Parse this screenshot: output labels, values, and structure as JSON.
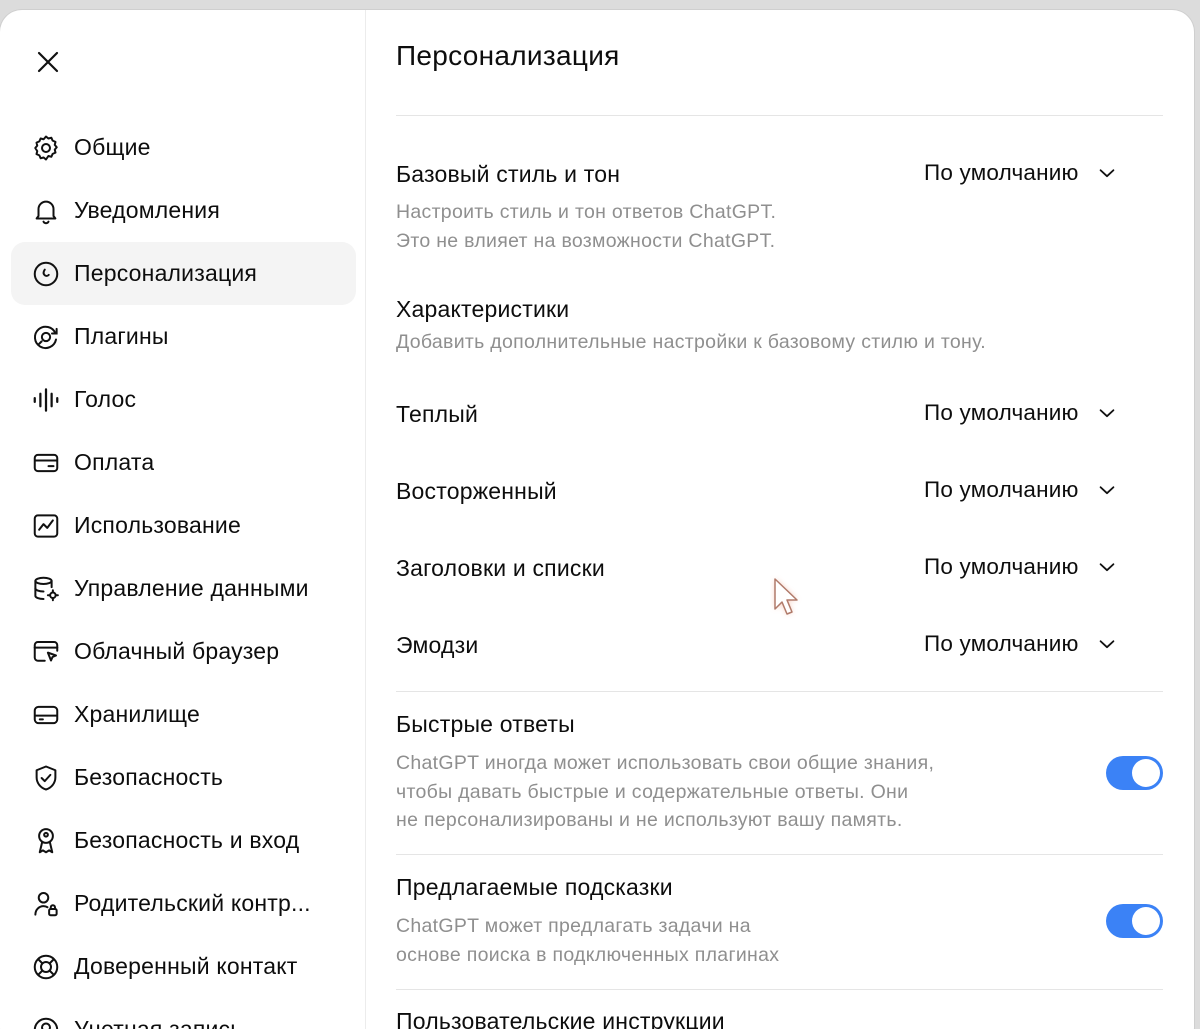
{
  "sidebar": {
    "close_icon": "close-icon",
    "items": [
      {
        "label": "Общие",
        "icon": "gear-icon",
        "active": false
      },
      {
        "label": "Уведомления",
        "icon": "bell-icon",
        "active": false
      },
      {
        "label": "Персонализация",
        "icon": "personalization-icon",
        "active": true
      },
      {
        "label": "Плагины",
        "icon": "plugins-icon",
        "active": false
      },
      {
        "label": "Голос",
        "icon": "voice-waveform-icon",
        "active": false
      },
      {
        "label": "Оплата",
        "icon": "credit-card-icon",
        "active": false
      },
      {
        "label": "Использование",
        "icon": "usage-chart-icon",
        "active": false
      },
      {
        "label": "Управление данными",
        "icon": "database-gear-icon",
        "active": false
      },
      {
        "label": "Облачный браузер",
        "icon": "cloud-browser-icon",
        "active": false
      },
      {
        "label": "Хранилище",
        "icon": "storage-icon",
        "active": false
      },
      {
        "label": "Безопасность",
        "icon": "shield-check-icon",
        "active": false
      },
      {
        "label": "Безопасность и вход",
        "icon": "key-icon",
        "active": false
      },
      {
        "label": "Родительский контр...",
        "icon": "parent-user-icon",
        "active": false
      },
      {
        "label": "Доверенный контакт",
        "icon": "lifebuoy-icon",
        "active": false
      },
      {
        "label": "Учетная запись",
        "icon": "account-icon",
        "active": false
      }
    ]
  },
  "main": {
    "title": "Персонализация",
    "base_style": {
      "title": "Базовый стиль и тон",
      "value": "По умолчанию",
      "desc_line1": "Настроить стиль и тон ответов ChatGPT.",
      "desc_line2": "Это не влияет на возможности ChatGPT."
    },
    "characteristics": {
      "title": "Характеристики",
      "desc": "Добавить дополнительные настройки к базовому стилю и тону."
    },
    "warm": {
      "title": "Теплый",
      "value": "По умолчанию"
    },
    "enthusiastic": {
      "title": "Восторженный",
      "value": "По умолчанию"
    },
    "headers_lists": {
      "title": "Заголовки и списки",
      "value": "По умолчанию"
    },
    "emoji": {
      "title": "Эмодзи",
      "value": "По умолчанию"
    },
    "quick_answers": {
      "title": "Быстрые ответы",
      "desc_line1": "ChatGPT иногда может использовать свои общие знания,",
      "desc_line2": "чтобы давать быстрые и содержательные ответы. Они",
      "desc_line3": "не персонализированы и не используют вашу память.",
      "enabled": true
    },
    "suggestions": {
      "title": "Предлагаемые подсказки",
      "desc_line1": "ChatGPT может предлагать задачи на",
      "desc_line2": "основе поиска в подключенных плагинах",
      "enabled": true
    },
    "custom_instructions": {
      "title": "Пользовательские инструкции"
    }
  },
  "colors": {
    "toggle_on": "#3b82f6",
    "active_bg": "#f4f4f4",
    "muted_text": "#8f8f8f"
  }
}
